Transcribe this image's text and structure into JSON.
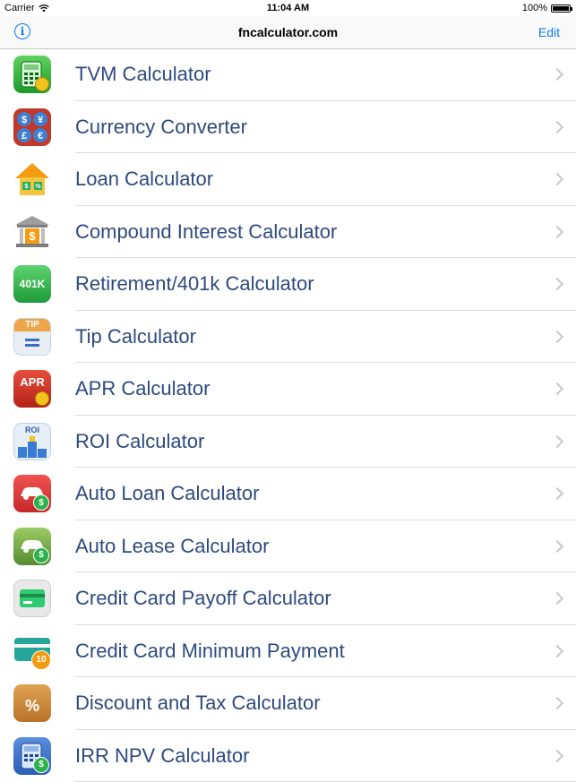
{
  "status_bar": {
    "carrier": "Carrier",
    "time": "11:04 AM",
    "battery": "100%"
  },
  "nav": {
    "title": "fncalculator.com",
    "edit_label": "Edit",
    "info_label": "i"
  },
  "items": [
    {
      "label": "TVM Calculator",
      "icon": "calculator-coins-icon"
    },
    {
      "label": "Currency Converter",
      "icon": "currency-icon"
    },
    {
      "label": "Loan Calculator",
      "icon": "house-loan-icon"
    },
    {
      "label": "Compound Interest Calculator",
      "icon": "bank-icon"
    },
    {
      "label": "Retirement/401k Calculator",
      "icon": "401k-icon",
      "icon_text": "401K"
    },
    {
      "label": "Tip Calculator",
      "icon": "tip-icon",
      "icon_text": "TIP"
    },
    {
      "label": "APR Calculator",
      "icon": "apr-icon",
      "icon_text": "APR"
    },
    {
      "label": "ROI Calculator",
      "icon": "roi-icon",
      "icon_text": "ROI"
    },
    {
      "label": "Auto Loan Calculator",
      "icon": "car-red-icon"
    },
    {
      "label": "Auto Lease Calculator",
      "icon": "car-green-icon"
    },
    {
      "label": "Credit Card Payoff Calculator",
      "icon": "credit-card-icon"
    },
    {
      "label": "Credit Card Minimum Payment",
      "icon": "credit-card-minimum-icon",
      "icon_text": "10"
    },
    {
      "label": "Discount and Tax Calculator",
      "icon": "shopping-bag-icon",
      "icon_text": "%"
    },
    {
      "label": "IRR NPV Calculator",
      "icon": "calculator-blue-icon"
    }
  ],
  "colors": {
    "accent": "#0a7aff",
    "label": "#2d4a7e",
    "separator": "#dcdcdf"
  }
}
